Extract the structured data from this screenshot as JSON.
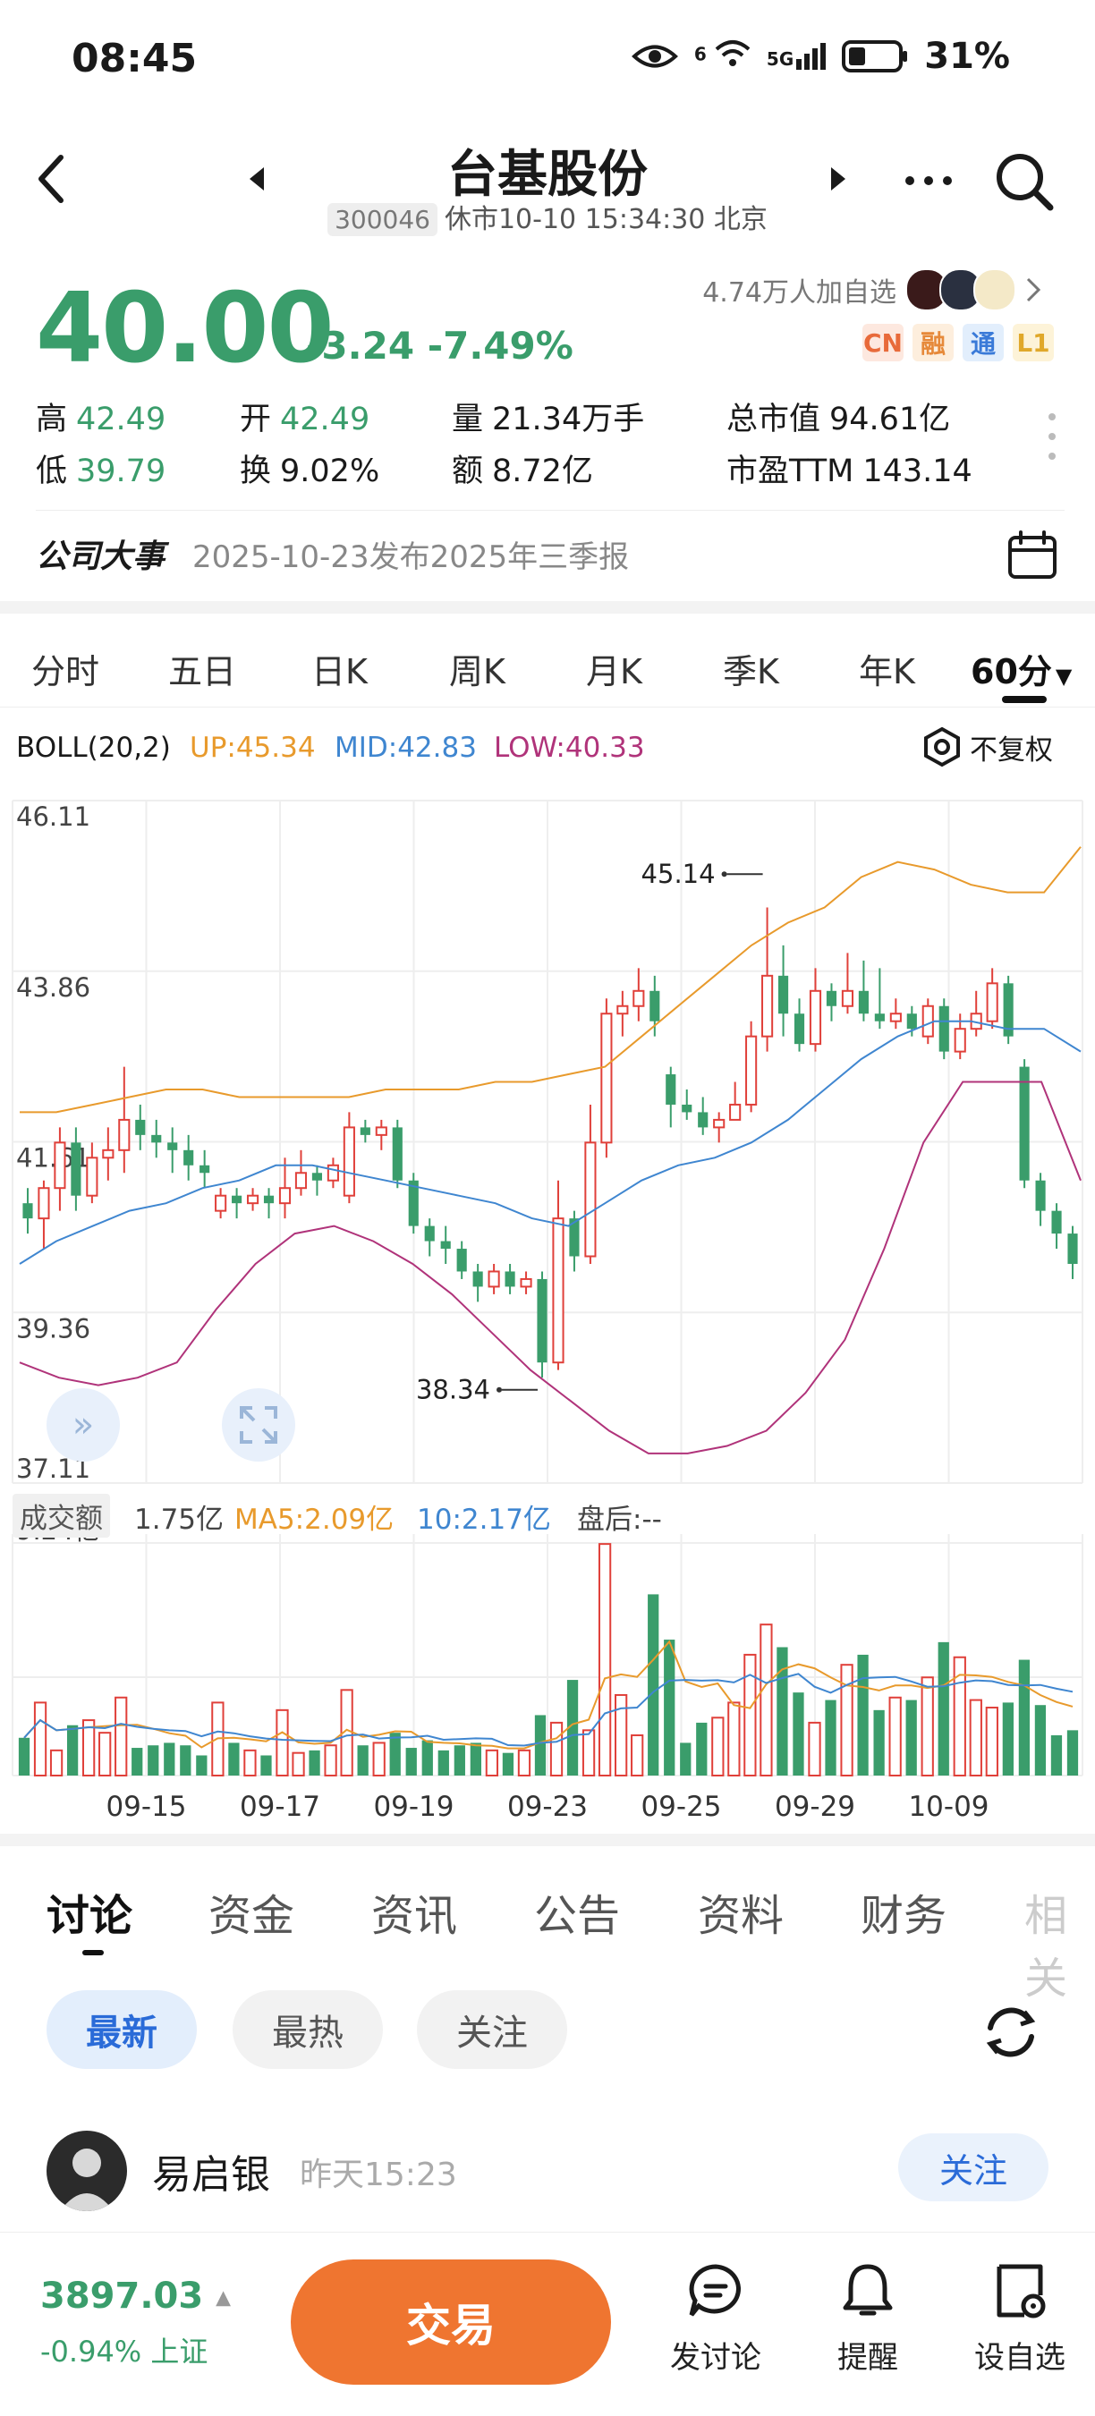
{
  "status_bar": {
    "time": "08:45",
    "network_a": "6",
    "network_b": "5G",
    "battery": "31%"
  },
  "header": {
    "title": "台基股份",
    "code": "300046",
    "market_status": "休市10-10 15:34:30 北京"
  },
  "quote": {
    "price": "40.00",
    "change": "-3.24",
    "change_pct": "-7.49%",
    "watchers": "4.74万人加自选",
    "badges": [
      "CN",
      "融",
      "通",
      "L1"
    ],
    "stats": {
      "high_label": "高",
      "high": "42.49",
      "open_label": "开",
      "open": "42.49",
      "volume_label": "量",
      "volume": "21.34万手",
      "mktcap_label": "总市值",
      "mktcap": "94.61亿",
      "low_label": "低",
      "low": "39.79",
      "turnover_label": "换",
      "turnover": "9.02%",
      "amount_label": "额",
      "amount": "8.72亿",
      "pe_label": "市盈TTM",
      "pe": "143.14"
    }
  },
  "event": {
    "label": "公司大事",
    "text": "2025-10-23发布2025年三季报"
  },
  "period_tabs": [
    "分时",
    "五日",
    "日K",
    "周K",
    "月K",
    "季K",
    "年K",
    "60分"
  ],
  "active_period": "60分",
  "chart_data": {
    "type": "candlestick",
    "indicator": {
      "name": "BOLL(20,2)",
      "up": "UP:45.34",
      "mid": "MID:42.83",
      "low": "LOW:40.33",
      "up_color": "#e89a2c",
      "mid_color": "#3f86d0",
      "low_color": "#b0337a"
    },
    "adjust_label": "不复权",
    "y_ticks": [
      "46.11",
      "43.86",
      "41.61",
      "39.36",
      "37.11"
    ],
    "ylim": [
      37.11,
      46.11
    ],
    "annotations": {
      "high": "45.14",
      "low": "38.34"
    },
    "x_ticks": [
      "09-15",
      "09-17",
      "09-19",
      "09-23",
      "09-25",
      "09-29",
      "10-09"
    ],
    "candles": [
      [
        40.8,
        40.6,
        41.0,
        40.4
      ],
      [
        40.6,
        41.0,
        41.1,
        40.2
      ],
      [
        41.0,
        41.6,
        41.8,
        40.7
      ],
      [
        41.6,
        40.9,
        41.8,
        40.7
      ],
      [
        40.9,
        41.4,
        41.6,
        40.8
      ],
      [
        41.4,
        41.5,
        41.8,
        41.1
      ],
      [
        41.5,
        41.9,
        42.6,
        41.2
      ],
      [
        41.9,
        41.7,
        42.1,
        41.5
      ],
      [
        41.7,
        41.6,
        41.9,
        41.4
      ],
      [
        41.6,
        41.5,
        41.8,
        41.2
      ],
      [
        41.5,
        41.3,
        41.7,
        41.1
      ],
      [
        41.3,
        41.2,
        41.5,
        41.0
      ],
      [
        40.7,
        40.9,
        41.0,
        40.6
      ],
      [
        40.9,
        40.8,
        41.0,
        40.6
      ],
      [
        40.8,
        40.9,
        41.0,
        40.7
      ],
      [
        40.9,
        40.8,
        41.0,
        40.6
      ],
      [
        40.8,
        41.0,
        41.4,
        40.6
      ],
      [
        41.0,
        41.2,
        41.5,
        40.9
      ],
      [
        41.2,
        41.1,
        41.3,
        40.9
      ],
      [
        41.1,
        41.3,
        41.4,
        41.0
      ],
      [
        40.9,
        41.8,
        42.0,
        40.8
      ],
      [
        41.8,
        41.7,
        41.9,
        41.6
      ],
      [
        41.7,
        41.8,
        41.9,
        41.5
      ],
      [
        41.8,
        41.1,
        41.9,
        41.0
      ],
      [
        41.1,
        40.5,
        41.2,
        40.4
      ],
      [
        40.5,
        40.3,
        40.6,
        40.1
      ],
      [
        40.3,
        40.2,
        40.5,
        40.0
      ],
      [
        40.2,
        39.9,
        40.3,
        39.8
      ],
      [
        39.9,
        39.7,
        40.0,
        39.5
      ],
      [
        39.7,
        39.9,
        40.0,
        39.6
      ],
      [
        39.9,
        39.7,
        40.0,
        39.6
      ],
      [
        39.7,
        39.8,
        39.9,
        39.6
      ],
      [
        39.8,
        38.7,
        39.9,
        38.5
      ],
      [
        38.7,
        40.6,
        41.1,
        38.6
      ],
      [
        40.6,
        40.1,
        40.7,
        39.9
      ],
      [
        40.1,
        41.6,
        42.1,
        40.0
      ],
      [
        41.6,
        43.3,
        43.5,
        41.4
      ],
      [
        43.3,
        43.4,
        43.6,
        43.0
      ],
      [
        43.4,
        43.6,
        43.9,
        43.2
      ],
      [
        43.6,
        43.2,
        43.8,
        43.0
      ],
      [
        42.5,
        42.1,
        42.6,
        41.8
      ],
      [
        42.1,
        42.0,
        42.3,
        41.9
      ],
      [
        42.0,
        41.8,
        42.2,
        41.7
      ],
      [
        41.8,
        41.9,
        42.0,
        41.6
      ],
      [
        41.9,
        42.1,
        42.4,
        41.9
      ],
      [
        42.1,
        43.0,
        43.2,
        42.0
      ],
      [
        43.0,
        43.8,
        44.7,
        42.8
      ],
      [
        43.8,
        43.3,
        44.2,
        43.0
      ],
      [
        43.3,
        42.9,
        43.5,
        42.8
      ],
      [
        42.9,
        43.6,
        43.9,
        42.8
      ],
      [
        43.6,
        43.4,
        43.7,
        43.2
      ],
      [
        43.4,
        43.6,
        44.1,
        43.3
      ],
      [
        43.6,
        43.3,
        44.0,
        43.2
      ],
      [
        43.3,
        43.2,
        43.9,
        43.1
      ],
      [
        43.2,
        43.3,
        43.5,
        43.1
      ],
      [
        43.3,
        43.1,
        43.4,
        43.0
      ],
      [
        43.0,
        43.4,
        43.5,
        42.9
      ],
      [
        43.4,
        42.8,
        43.5,
        42.7
      ],
      [
        42.8,
        43.1,
        43.3,
        42.7
      ],
      [
        43.1,
        43.3,
        43.6,
        43.0
      ],
      [
        43.2,
        43.7,
        43.9,
        43.1
      ],
      [
        43.7,
        43.0,
        43.8,
        42.9
      ],
      [
        42.6,
        41.1,
        42.7,
        41.0
      ],
      [
        41.1,
        40.7,
        41.2,
        40.5
      ],
      [
        40.7,
        40.4,
        40.8,
        40.2
      ],
      [
        40.4,
        40.0,
        40.5,
        39.8
      ]
    ],
    "boll_up": [
      42.0,
      42.0,
      42.1,
      42.2,
      42.3,
      42.3,
      42.2,
      42.2,
      42.2,
      42.2,
      42.3,
      42.3,
      42.3,
      42.4,
      42.4,
      42.5,
      42.6,
      43.0,
      43.4,
      43.8,
      44.2,
      44.5,
      44.7,
      45.1,
      45.3,
      45.2,
      45.0,
      44.9,
      44.9,
      45.5
    ],
    "boll_mid": [
      40.0,
      40.3,
      40.5,
      40.7,
      40.8,
      41.0,
      41.1,
      41.3,
      41.3,
      41.2,
      41.1,
      41.0,
      40.9,
      40.8,
      40.6,
      40.5,
      40.8,
      41.1,
      41.3,
      41.4,
      41.6,
      41.9,
      42.3,
      42.7,
      43.0,
      43.2,
      43.2,
      43.1,
      43.1,
      42.8
    ],
    "boll_low": [
      38.7,
      38.5,
      38.4,
      38.5,
      38.7,
      39.4,
      40.0,
      40.4,
      40.5,
      40.3,
      40.0,
      39.6,
      39.1,
      38.6,
      38.2,
      37.8,
      37.5,
      37.5,
      37.6,
      37.8,
      38.3,
      39.0,
      40.2,
      41.6,
      42.4,
      42.4,
      42.4,
      41.1
    ],
    "volume_panel": {
      "label": "成交额",
      "value": "1.75亿",
      "ma5": "MA5:2.09亿",
      "ma10": "10:2.17亿",
      "after_hours": "盘后:--",
      "max_tick": "9.24亿",
      "values": [
        1.5,
        2.9,
        1.0,
        2.0,
        2.2,
        1.7,
        3.1,
        1.1,
        1.2,
        1.3,
        1.2,
        0.8,
        2.9,
        1.3,
        1.0,
        0.8,
        2.6,
        0.9,
        1.0,
        1.2,
        3.4,
        1.2,
        1.3,
        1.7,
        1.1,
        1.4,
        1.0,
        1.2,
        1.3,
        1.0,
        0.9,
        1.0,
        2.4,
        2.1,
        3.8,
        1.8,
        9.2,
        3.2,
        1.6,
        7.2,
        5.4,
        1.3,
        2.1,
        2.3,
        2.9,
        4.8,
        6.0,
        5.1,
        3.3,
        2.1,
        3.0,
        4.4,
        4.8,
        2.6,
        3.1,
        3.0,
        3.9,
        5.3,
        4.7,
        3.0,
        2.7,
        2.9,
        4.6,
        2.8,
        1.6,
        1.8
      ]
    }
  },
  "content_tabs": [
    "讨论",
    "资金",
    "资讯",
    "公告",
    "资料",
    "财务",
    "相关"
  ],
  "active_content_tab": "讨论",
  "filters": [
    "最新",
    "最热",
    "关注"
  ],
  "post": {
    "author": "易启银",
    "time": "昨天15:23",
    "follow": "关注"
  },
  "bottom_bar": {
    "index_value": "3897.03",
    "index_change": "-0.94% 上证",
    "trade": "交易",
    "actions": [
      "发讨论",
      "提醒",
      "设自选"
    ]
  },
  "colors": {
    "up": "#e0403a",
    "down": "#3a9d6b",
    "accent": "#ef7530",
    "blue": "#2a6bd8"
  }
}
